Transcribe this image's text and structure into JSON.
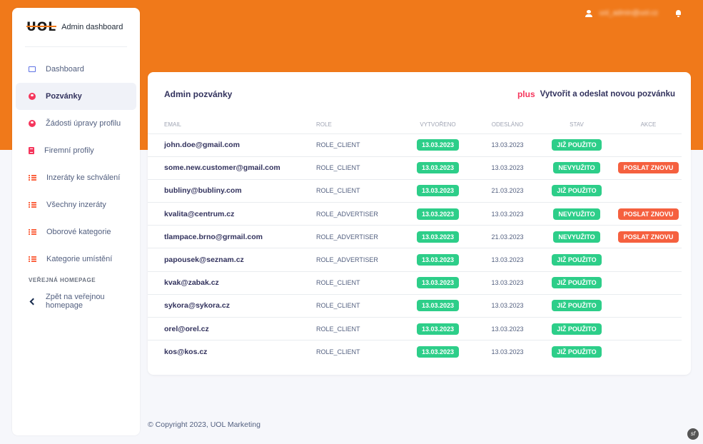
{
  "colors": {
    "brand": "#f0791a",
    "success": "#2dce89",
    "danger": "#f5603f"
  },
  "topbar": {
    "user_email": "uol_admin@uol.cz",
    "user_icon": "user-icon",
    "bell_icon": "bell-icon"
  },
  "sidebar": {
    "logo": "UOL",
    "brand_title": "Admin dashboard",
    "items": [
      {
        "label": "Dashboard",
        "icon": "monitor-icon",
        "active": false
      },
      {
        "label": "Pozvánky",
        "icon": "user-circle-icon",
        "active": true
      },
      {
        "label": "Žádosti úpravy profilu",
        "icon": "user-circle-icon",
        "active": false
      },
      {
        "label": "Firemní profily",
        "icon": "building-icon",
        "active": false
      },
      {
        "label": "Inzeráty ke schválení",
        "icon": "list-icon",
        "active": false
      },
      {
        "label": "Všechny inzeráty",
        "icon": "list-icon",
        "active": false
      },
      {
        "label": "Oborové kategorie",
        "icon": "list-icon",
        "active": false
      },
      {
        "label": "Kategorie umístění",
        "icon": "list-icon",
        "active": false
      }
    ],
    "section_heading": "VEŘEJNÁ HOMEPAGE",
    "back_link": {
      "label": "Zpět na veřejnou homepage",
      "icon": "chevron-left-icon"
    }
  },
  "card": {
    "title": "Admin pozvánky",
    "create_icon": "plus",
    "create_label": "Vytvořit a odeslat novou pozvánku",
    "columns": [
      "EMAIL",
      "ROLE",
      "VYTVOŘENO",
      "ODESLÁNO",
      "STAV",
      "AKCE"
    ],
    "rows": [
      {
        "email": "john.doe@gmail.com",
        "role": "ROLE_CLIENT",
        "created": "13.03.2023",
        "sent": "13.03.2023",
        "state": "JIŽ POUŽITO",
        "action": ""
      },
      {
        "email": "some.new.customer@gmail.com",
        "role": "ROLE_CLIENT",
        "created": "13.03.2023",
        "sent": "13.03.2023",
        "state": "NEVYUŽITO",
        "action": "POSLAT ZNOVU"
      },
      {
        "email": "bubliny@bubliny.com",
        "role": "ROLE_CLIENT",
        "created": "13.03.2023",
        "sent": "21.03.2023",
        "state": "JIŽ POUŽITO",
        "action": ""
      },
      {
        "email": "kvalita@centrum.cz",
        "role": "ROLE_ADVERTISER",
        "created": "13.03.2023",
        "sent": "13.03.2023",
        "state": "NEVYUŽITO",
        "action": "POSLAT ZNOVU"
      },
      {
        "email": "tlampace.brno@grmail.com",
        "role": "ROLE_ADVERTISER",
        "created": "13.03.2023",
        "sent": "21.03.2023",
        "state": "NEVYUŽITO",
        "action": "POSLAT ZNOVU"
      },
      {
        "email": "papousek@seznam.cz",
        "role": "ROLE_ADVERTISER",
        "created": "13.03.2023",
        "sent": "13.03.2023",
        "state": "JIŽ POUŽITO",
        "action": ""
      },
      {
        "email": "kvak@zabak.cz",
        "role": "ROLE_CLIENT",
        "created": "13.03.2023",
        "sent": "13.03.2023",
        "state": "JIŽ POUŽITO",
        "action": ""
      },
      {
        "email": "sykora@sykora.cz",
        "role": "ROLE_CLIENT",
        "created": "13.03.2023",
        "sent": "13.03.2023",
        "state": "JIŽ POUŽITO",
        "action": ""
      },
      {
        "email": "orel@orel.cz",
        "role": "ROLE_CLIENT",
        "created": "13.03.2023",
        "sent": "13.03.2023",
        "state": "JIŽ POUŽITO",
        "action": ""
      },
      {
        "email": "kos@kos.cz",
        "role": "ROLE_CLIENT",
        "created": "13.03.2023",
        "sent": "13.03.2023",
        "state": "JIŽ POUŽITO",
        "action": ""
      }
    ]
  },
  "footer": {
    "copyright": "© Copyright 2023, UOL Marketing",
    "sf_badge": "sf"
  }
}
